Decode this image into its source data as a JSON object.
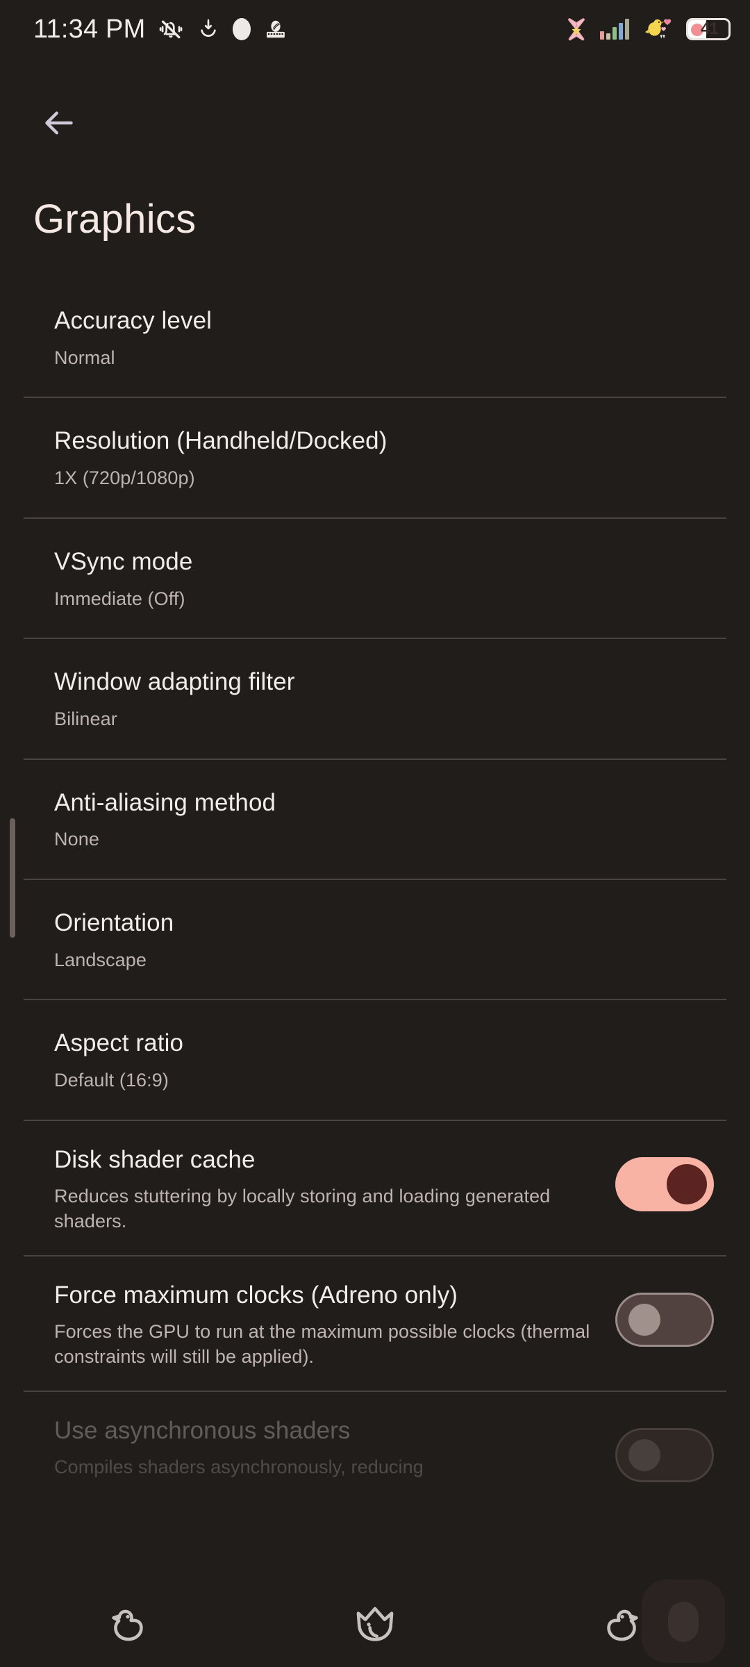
{
  "statusbar": {
    "time": "11:34 PM",
    "left_icons": [
      "vibrate-off-icon",
      "download-tray-icon",
      "white-blob-icon",
      "device-cast-icon"
    ],
    "right_icons": [
      "pink-bow-icon",
      "signal-bars-icon",
      "duck-heart-icon",
      "battery-icon"
    ],
    "signal_bar_colors": [
      "#E79A98",
      "#C9BFAE",
      "#8FBF86",
      "#7FA9D6",
      "#A8A894"
    ],
    "battery_level": "41",
    "battery_accent": "#F08F94"
  },
  "header": {
    "back_icon": "arrow-left-icon",
    "title": "Graphics"
  },
  "settings": [
    {
      "title": "Accuracy level",
      "value": "Normal",
      "control": "none"
    },
    {
      "title": "Resolution (Handheld/Docked)",
      "value": "1X (720p/1080p)",
      "control": "none"
    },
    {
      "title": "VSync mode",
      "value": "Immediate (Off)",
      "control": "none"
    },
    {
      "title": "Window adapting filter",
      "value": "Bilinear",
      "control": "none"
    },
    {
      "title": "Anti-aliasing method",
      "value": "None",
      "control": "none"
    },
    {
      "title": "Orientation",
      "value": "Landscape",
      "control": "none"
    },
    {
      "title": "Aspect ratio",
      "value": "Default (16:9)",
      "control": "none"
    },
    {
      "title": "Disk shader cache",
      "value": "Reduces stuttering by locally storing and loading generated shaders.",
      "control": "switch",
      "checked": true
    },
    {
      "title": "Force maximum clocks (Adreno only)",
      "value": "Forces the GPU to run at the maximum possible clocks (thermal constraints will still be applied).",
      "control": "switch",
      "checked": false
    },
    {
      "title": "Use asynchronous shaders",
      "value": "Compiles shaders asynchronously, reducing",
      "control": "switch",
      "checked": false
    }
  ],
  "theme": {
    "background": "#211D1B",
    "divider": "#4B4340",
    "title_text": "#F2EDEA",
    "subtitle_text": "#BDB4B1",
    "accent_on_track": "#F9B3A5",
    "accent_on_thumb": "#5B2420",
    "off_track": "#51423F",
    "off_thumb": "#A0918D"
  },
  "navbar": {
    "back_icon": "duck-back-icon",
    "home_icon": "crown-home-icon",
    "recents_icon": "duck-recents-icon"
  }
}
